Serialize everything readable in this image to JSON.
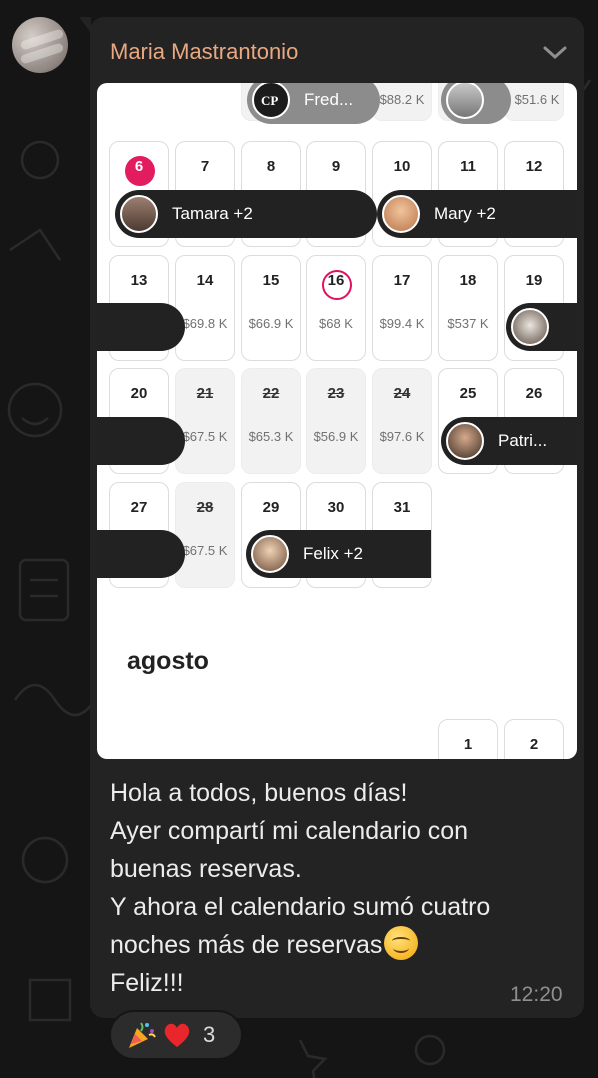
{
  "chat": {
    "sender": "Maria Mastrantonio",
    "message_lines": [
      "Hola a todos, buenos días!",
      "Ayer compartí mi calendario con",
      "buenas reservas.",
      "Y ahora el calendario sumó cuatro",
      "noches más de reservas",
      "Feliz!!!"
    ],
    "message_emoji": "smiling-face-emoji",
    "time": "12:20",
    "reactions": {
      "emojis": [
        "party-popper-emoji",
        "red-heart-emoji"
      ],
      "count": "3"
    }
  },
  "calendar": {
    "top_row": {
      "pill1_label": "Fred...",
      "price1": "$88.2 K",
      "price2": "$51.6 K"
    },
    "days": [
      {
        "day": "6",
        "highlight": "red"
      },
      {
        "day": "7"
      },
      {
        "day": "8"
      },
      {
        "day": "9"
      },
      {
        "day": "10"
      },
      {
        "day": "11"
      },
      {
        "day": "12"
      },
      {
        "day": "13"
      },
      {
        "day": "14",
        "price": "$69.8 K"
      },
      {
        "day": "15",
        "price": "$66.9 K"
      },
      {
        "day": "16",
        "price": "$68 K",
        "highlight": "today"
      },
      {
        "day": "17",
        "price": "$99.4 K"
      },
      {
        "day": "18",
        "price": "$537 K"
      },
      {
        "day": "19"
      },
      {
        "day": "20"
      },
      {
        "day": "21",
        "price": "$67.5 K",
        "struck": true
      },
      {
        "day": "22",
        "price": "$65.3 K",
        "struck": true
      },
      {
        "day": "23",
        "price": "$56.9 K",
        "struck": true
      },
      {
        "day": "24",
        "price": "$97.6 K",
        "struck": true
      },
      {
        "day": "25"
      },
      {
        "day": "26"
      },
      {
        "day": "27"
      },
      {
        "day": "28",
        "price": "$67.5 K",
        "struck": true
      },
      {
        "day": "29"
      },
      {
        "day": "30"
      },
      {
        "day": "31"
      }
    ],
    "bookings": [
      "Tamara +2",
      "Mary +2",
      "Patri...",
      "Felix +2"
    ],
    "next_month": "agosto",
    "next_month_days": [
      "1",
      "2"
    ]
  }
}
